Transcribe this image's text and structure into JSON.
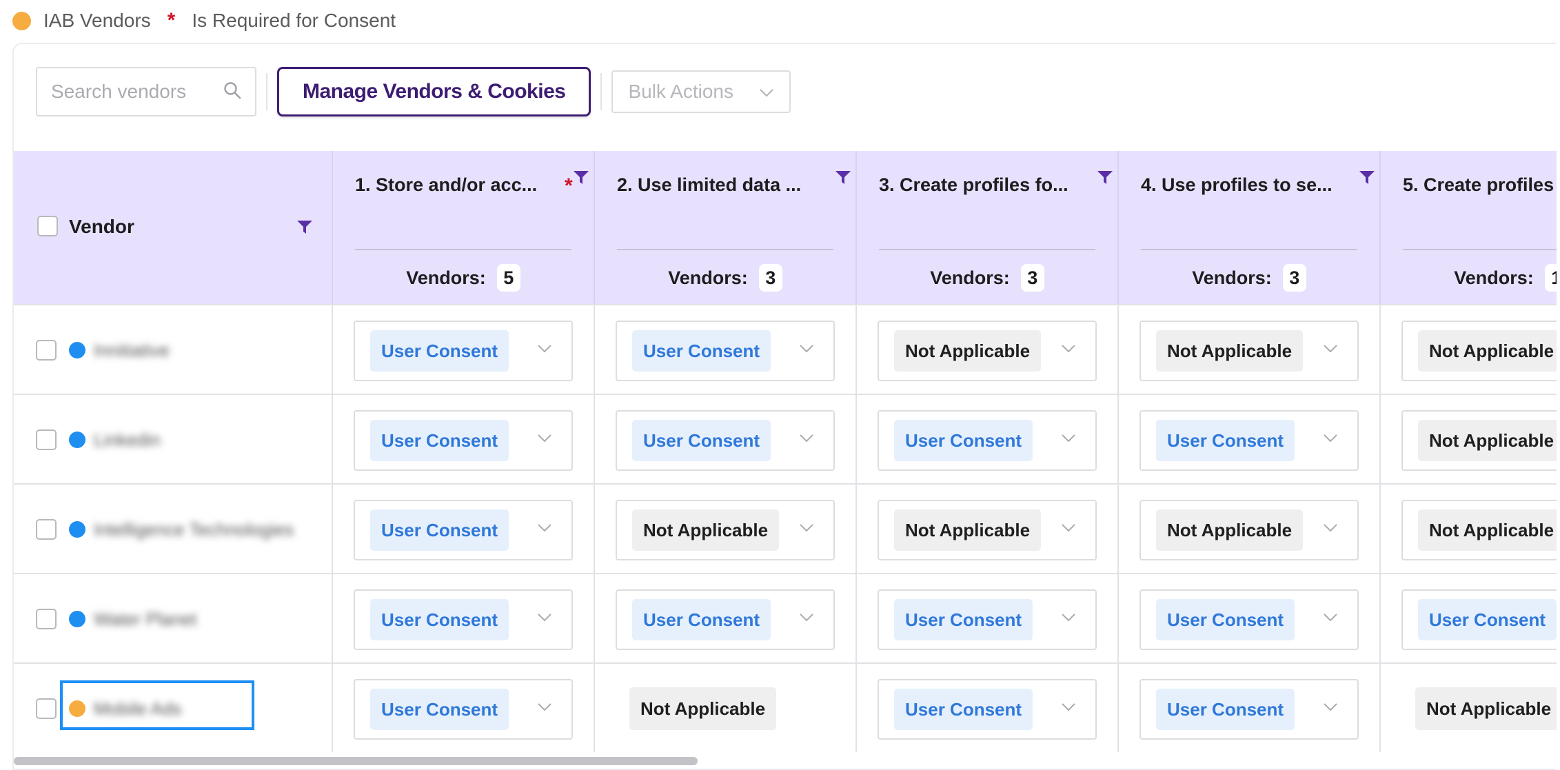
{
  "legend": {
    "iab_label": "IAB Vendors",
    "required_star": "*",
    "required_label": "Is Required for Consent",
    "iab_color": "#f6ac3f"
  },
  "toolbar": {
    "search_placeholder": "Search vendors",
    "search_icon": "search-icon",
    "manage_label": "Manage Vendors & Cookies",
    "bulk_label": "Bulk Actions"
  },
  "table": {
    "vendor_header": "Vendor",
    "vendors_label": "Vendors:",
    "columns": [
      {
        "title": "1. Store and/or acc...",
        "required": "*",
        "count": "5"
      },
      {
        "title": "2. Use limited data ...",
        "required": "",
        "count": "3"
      },
      {
        "title": "3. Create profiles fo...",
        "required": "",
        "count": "3"
      },
      {
        "title": "4. Use profiles to se...",
        "required": "",
        "count": "3"
      },
      {
        "title": "5. Create profiles",
        "required": "",
        "count": "1"
      }
    ],
    "rows": [
      {
        "vendor_name": "Innitiative",
        "dot_color": "#1f8ef1",
        "values": [
          "User Consent",
          "User Consent",
          "Not Applicable",
          "Not Applicable",
          "Not Applicable"
        ]
      },
      {
        "vendor_name": "Linkedin",
        "dot_color": "#1f8ef1",
        "values": [
          "User Consent",
          "User Consent",
          "User Consent",
          "User Consent",
          "Not Applicable"
        ]
      },
      {
        "vendor_name": "Intelligence Technologies",
        "dot_color": "#1f8ef1",
        "values": [
          "User Consent",
          "Not Applicable",
          "Not Applicable",
          "Not Applicable",
          "Not Applicable"
        ]
      },
      {
        "vendor_name": "Water Planet",
        "dot_color": "#1f8ef1",
        "values": [
          "User Consent",
          "User Consent",
          "User Consent",
          "User Consent",
          "User Consent"
        ]
      },
      {
        "vendor_name": "Mobile Ads",
        "dot_color": "#f6ac3f",
        "values": [
          "User Consent",
          "Not Applicable",
          "User Consent",
          "User Consent",
          "Not Applicable"
        ]
      }
    ]
  },
  "colors": {
    "header_bg": "#e8e1fd",
    "accent_purple": "#3d1d72",
    "consent_text": "#2f78d9",
    "consent_bg": "#e6f0fd",
    "required_red": "#d0142a"
  }
}
